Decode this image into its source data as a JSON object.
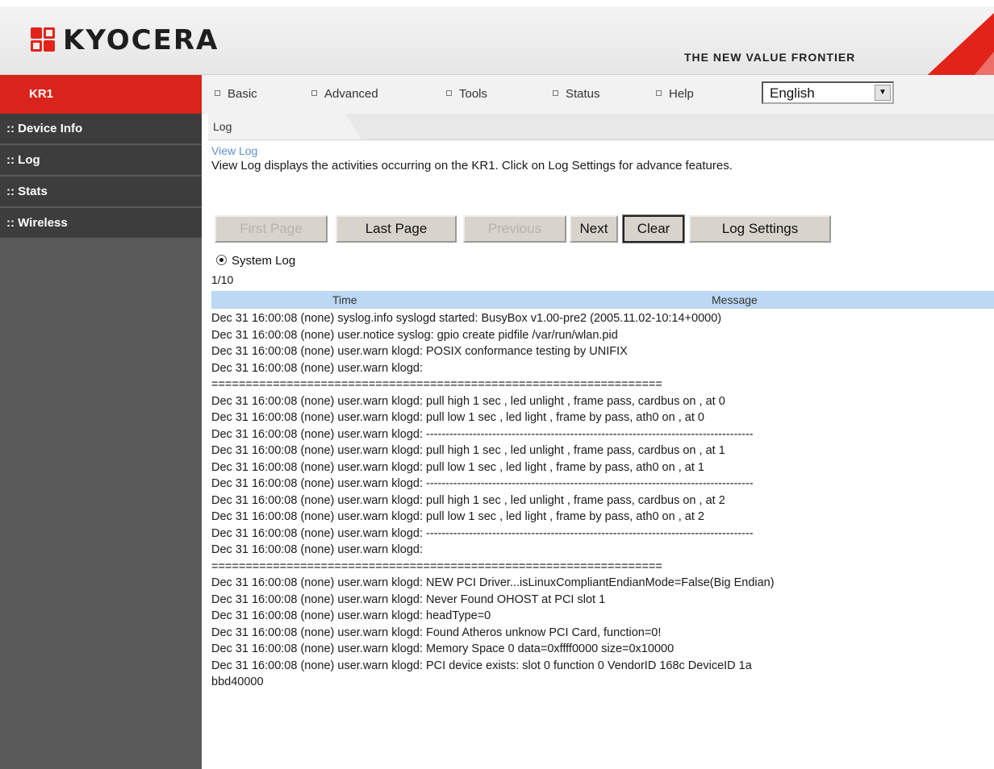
{
  "brand": {
    "logo_text": "KYOCERA",
    "tagline": "THE NEW VALUE FRONTIER",
    "accent": "#d9241b"
  },
  "nav": {
    "model": "KR1",
    "items": [
      {
        "label": "Basic"
      },
      {
        "label": "Advanced"
      },
      {
        "label": "Tools"
      },
      {
        "label": "Status"
      },
      {
        "label": "Help"
      }
    ],
    "language": "English"
  },
  "sidebar": {
    "items": [
      {
        "label": ":: Device Info"
      },
      {
        "label": ":: Log"
      },
      {
        "label": ":: Stats"
      },
      {
        "label": ":: Wireless"
      }
    ]
  },
  "main": {
    "section_title": "Log",
    "subtitle": "View Log",
    "description": "View Log displays the activities occurring on the KR1. Click on Log Settings for advance features.",
    "buttons": {
      "first_page": "First Page",
      "last_page": "Last Page",
      "previous": "Previous",
      "next": "Next",
      "clear": "Clear",
      "log_settings": "Log Settings"
    },
    "log_type": "System Log",
    "page_indicator": "1/10",
    "columns": {
      "time": "Time",
      "message": "Message"
    },
    "log_lines": [
      "Dec 31 16:00:08 (none) syslog.info syslogd started: BusyBox v1.00-pre2 (2005.11.02-10:14+0000)",
      "Dec 31 16:00:08 (none) user.notice syslog: gpio create pidfile /var/run/wlan.pid",
      "Dec 31 16:00:08 (none) user.warn klogd: POSIX conformance testing by UNIFIX",
      "Dec 31 16:00:08 (none) user.warn klogd:",
      "==================================================================",
      "Dec 31 16:00:08 (none) user.warn klogd: pull high 1 sec , led unlight , frame pass, cardbus on , at 0",
      "Dec 31 16:00:08 (none) user.warn klogd: pull low 1 sec , led light , frame by pass, ath0 on , at 0",
      "Dec 31 16:00:08 (none) user.warn klogd: ------------------------------------------------------------------------------------",
      "Dec 31 16:00:08 (none) user.warn klogd: pull high 1 sec , led unlight , frame pass, cardbus on , at 1",
      "Dec 31 16:00:08 (none) user.warn klogd: pull low 1 sec , led light , frame by pass, ath0 on , at 1",
      "Dec 31 16:00:08 (none) user.warn klogd: ------------------------------------------------------------------------------------",
      "Dec 31 16:00:08 (none) user.warn klogd: pull high 1 sec , led unlight , frame pass, cardbus on , at 2",
      "Dec 31 16:00:08 (none) user.warn klogd: pull low 1 sec , led light , frame by pass, ath0 on , at 2",
      "Dec 31 16:00:08 (none) user.warn klogd: ------------------------------------------------------------------------------------",
      "Dec 31 16:00:08 (none) user.warn klogd:",
      "==================================================================",
      "Dec 31 16:00:08 (none) user.warn klogd: NEW PCI Driver...isLinuxCompliantEndianMode=False(Big Endian)",
      "Dec 31 16:00:08 (none) user.warn klogd: Never Found OHOST at PCI slot 1",
      "Dec 31 16:00:08 (none) user.warn klogd: headType=0",
      "Dec 31 16:00:08 (none) user.warn klogd: Found Atheros unknow PCI Card, function=0!",
      "Dec 31 16:00:08 (none) user.warn klogd: Memory Space 0 data=0xffff0000 size=0x10000",
      "Dec 31 16:00:08 (none) user.warn klogd: PCI device exists: slot 0 function 0 VendorID 168c DeviceID 1a",
      "bbd40000"
    ]
  }
}
